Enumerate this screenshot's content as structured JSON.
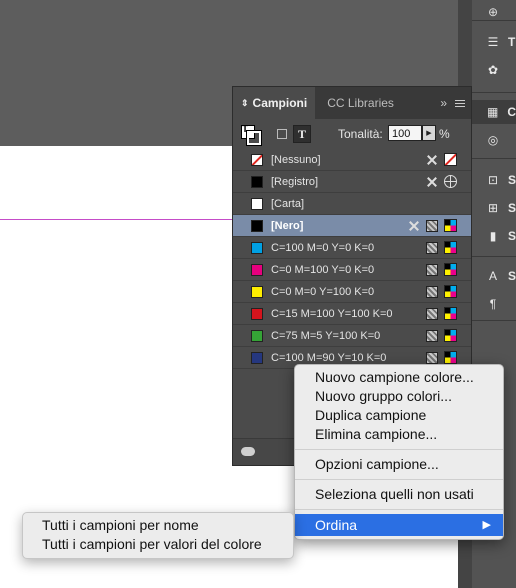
{
  "panel": {
    "tabs": [
      {
        "label": "Campioni",
        "active": true
      },
      {
        "label": "CC Libraries",
        "active": false
      }
    ],
    "expand_glyph": "»",
    "tint_label": "Tonalità:",
    "tint_value": "100",
    "tint_unit": "%",
    "type_button": "T",
    "fill_glyph": "T"
  },
  "swatches": [
    {
      "name": "[Nessuno]",
      "color": "none",
      "icons": [
        "no-edit-icon",
        "none-swatch-icon"
      ]
    },
    {
      "name": "[Registro]",
      "color": "#000000",
      "icons": [
        "no-edit-icon",
        "registration-icon"
      ]
    },
    {
      "name": "[Carta]",
      "color": "#ffffff",
      "icons": []
    },
    {
      "name": "[Nero]",
      "color": "#000000",
      "icons": [
        "no-edit-icon",
        "process-icon",
        "cmyk-icon"
      ],
      "selected": true
    },
    {
      "name": "C=100 M=0 Y=0 K=0",
      "color": "#00a0e3",
      "icons": [
        "process-icon",
        "cmyk-icon"
      ]
    },
    {
      "name": "C=0 M=100 Y=0 K=0",
      "color": "#e5007e",
      "icons": [
        "process-icon",
        "cmyk-icon"
      ]
    },
    {
      "name": "C=0 M=0 Y=100 K=0",
      "color": "#ffee00",
      "icons": [
        "process-icon",
        "cmyk-icon"
      ]
    },
    {
      "name": "C=15 M=100 Y=100 K=0",
      "color": "#d4141d",
      "icons": [
        "process-icon",
        "cmyk-icon"
      ]
    },
    {
      "name": "C=75 M=5 Y=100 K=0",
      "color": "#35a336",
      "icons": [
        "process-icon",
        "cmyk-icon"
      ]
    },
    {
      "name": "C=100 M=90 Y=10 K=0",
      "color": "#25377f",
      "icons": [
        "process-icon",
        "cmyk-icon"
      ]
    }
  ],
  "context_menu": {
    "group1": [
      "Nuovo campione colore...",
      "Nuovo gruppo colori...",
      "Duplica campione",
      "Elimina campione..."
    ],
    "group2": [
      "Opzioni campione..."
    ],
    "group3": [
      "Seleziona quelli non usati"
    ],
    "sort_label": "Ordina",
    "sort_arrow": "▶"
  },
  "submenu": {
    "items": [
      "Tutti i campioni per nome",
      "Tutti i campioni per valori del colore"
    ]
  },
  "dock": {
    "labels": [
      "T",
      "C",
      "S",
      "S",
      "S",
      "S"
    ]
  },
  "colors": {
    "highlight": "#2b6fe3",
    "guide": "#c54cc8",
    "selected_row": "#7a8ca8"
  }
}
